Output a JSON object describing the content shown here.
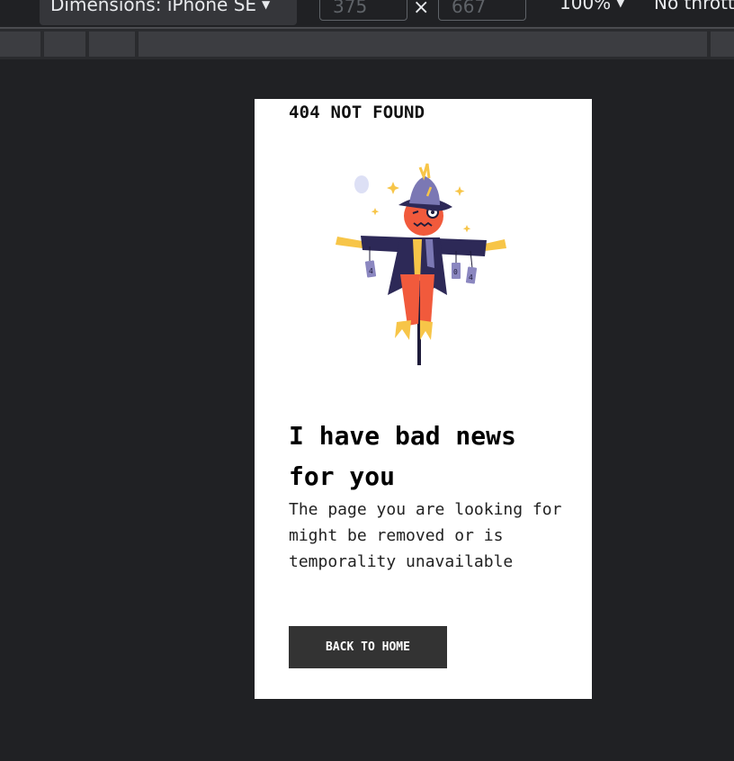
{
  "devtools": {
    "dimensions_label": "Dimensions: iPhone SE",
    "width_value": "375",
    "height_value": "667",
    "times_symbol": "×",
    "zoom_label": "100%",
    "throttle_label": "No throttling"
  },
  "page": {
    "not_found_title": "404 NOT FOUND",
    "headline": "I have bad news for you",
    "message": "The page you are looking for might be removed or is temporality unavailable",
    "button_label": "BACK TO HOME",
    "illustration": {
      "icon": "scarecrow-icon",
      "can_labels": [
        "4",
        "0",
        "4"
      ]
    }
  },
  "colors": {
    "devtools_bg": "#202124",
    "button_bg": "#333333",
    "scarecrow_face": "#f15a3c",
    "scarecrow_coat": "#2d2957",
    "scarecrow_straw": "#f7c548"
  }
}
